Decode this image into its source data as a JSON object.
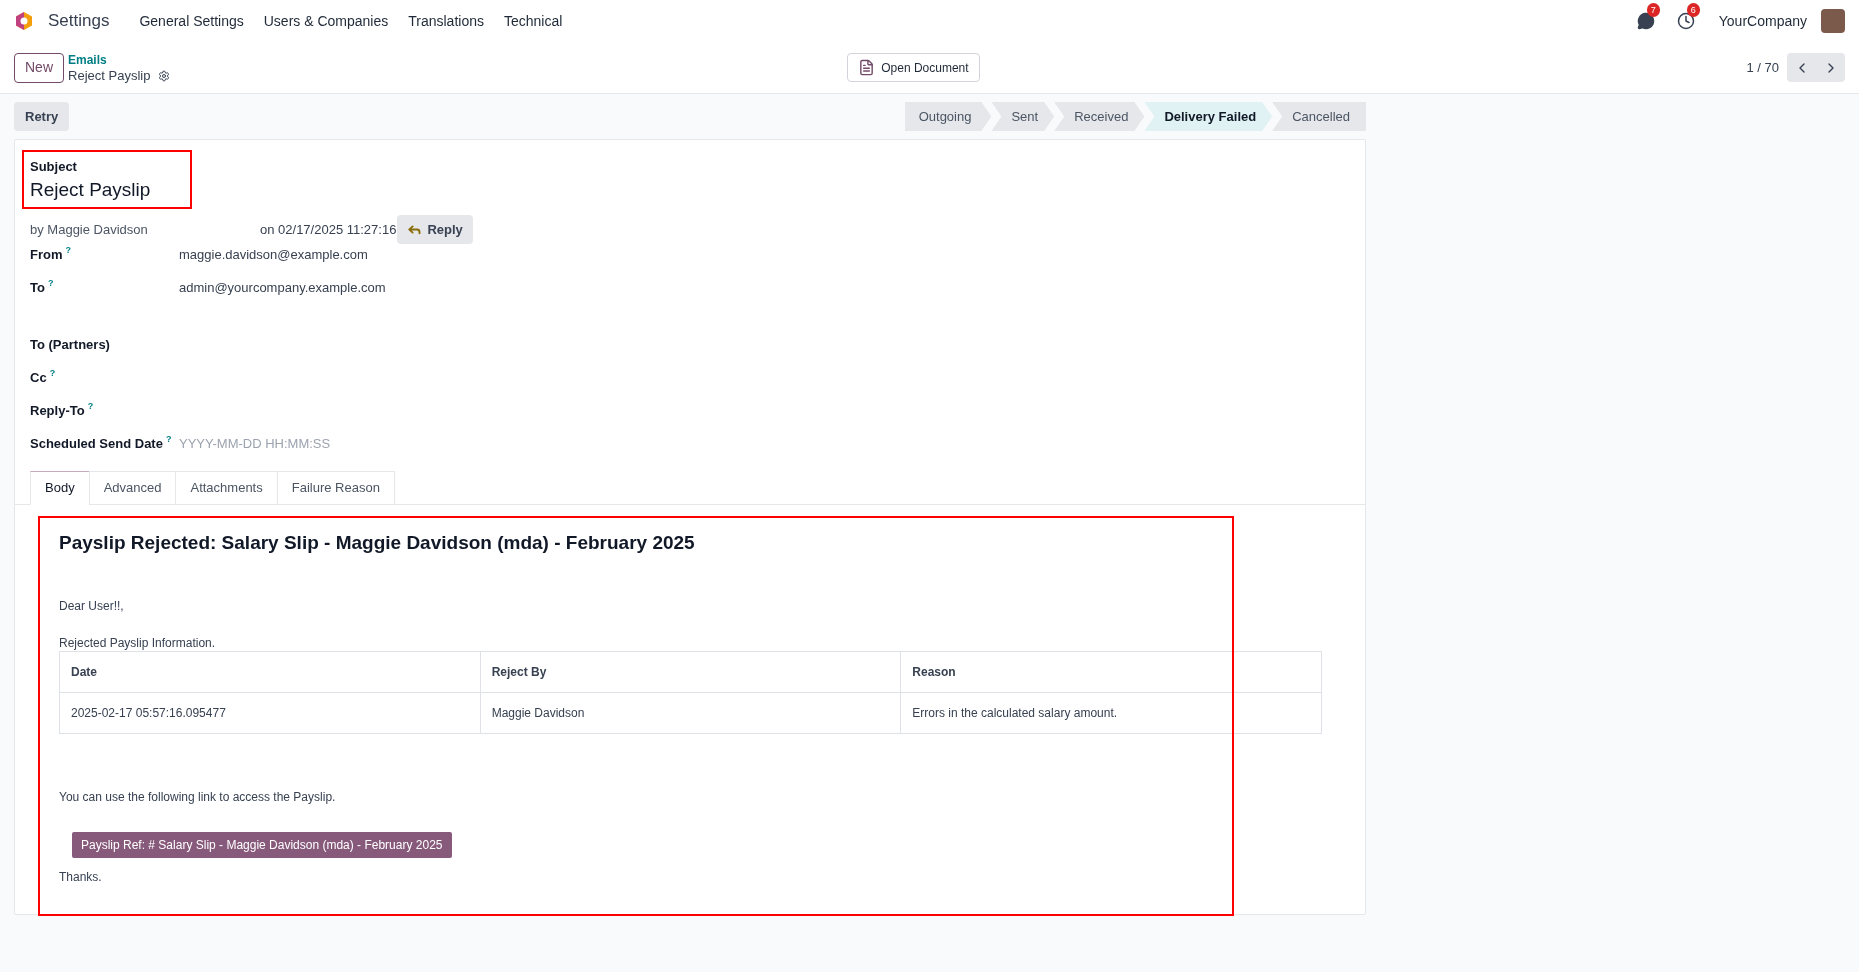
{
  "navbar": {
    "app_name": "Settings",
    "menu": [
      "General Settings",
      "Users & Companies",
      "Translations",
      "Technical"
    ],
    "messages_badge": "7",
    "activities_badge": "6",
    "company": "YourCompany"
  },
  "control_panel": {
    "new_button": "New",
    "breadcrumb": "Emails",
    "record_title": "Reject Payslip",
    "open_document": "Open Document",
    "pager": "1 / 70"
  },
  "actions": [
    "Retry"
  ],
  "statusbar": [
    {
      "label": "Outgoing",
      "selected": false
    },
    {
      "label": "Sent",
      "selected": false
    },
    {
      "label": "Received",
      "selected": false
    },
    {
      "label": "Delivery Failed",
      "selected": true
    },
    {
      "label": "Cancelled",
      "selected": false
    }
  ],
  "form": {
    "subject_label": "Subject",
    "subject": "Reject Payslip",
    "author": "by Maggie Davidson",
    "date": "on 02/17/2025 11:27:16",
    "reply_button": "Reply",
    "fields": [
      {
        "kind": "text",
        "label": "From",
        "help": "?",
        "value": "maggie.davidson@example.com"
      },
      {
        "kind": "text",
        "label": "To",
        "help": "?",
        "value": "admin@yourcompany.example.com"
      },
      {
        "kind": "tags",
        "label": "To (Partners)"
      },
      {
        "kind": "tags",
        "label": "Cc",
        "help": "?"
      },
      {
        "kind": "text",
        "label": "Reply-To",
        "help": "?"
      },
      {
        "kind": "datetime",
        "label": "Scheduled Send Date",
        "help": "?",
        "placeholder": "YYYY-MM-DD HH:MM:SS"
      }
    ],
    "tabs": [
      {
        "label": "Body",
        "selected": true
      },
      {
        "label": "Advanced",
        "selected": false
      },
      {
        "label": "Attachments",
        "selected": false
      },
      {
        "label": "Failure Reason",
        "selected": false
      }
    ],
    "body": {
      "heading": "Payslip Rejected: Salary Slip - Maggie Davidson (mda) - February 2025",
      "greeting": "Dear User!!,",
      "intro": "Rejected Payslip Information.",
      "table": {
        "columns": [
          "Date",
          "Reject By",
          "Reason"
        ],
        "rows": [
          [
            "2025-02-17 05:57:16.095477",
            "Maggie Davidson",
            "Errors in the calculated salary amount."
          ]
        ]
      },
      "link_text": "You can use the following link to access the Payslip.",
      "link_button": "Payslip Ref: # Salary Slip - Maggie Davidson (mda) - February 2025",
      "closing": "Thanks."
    }
  }
}
